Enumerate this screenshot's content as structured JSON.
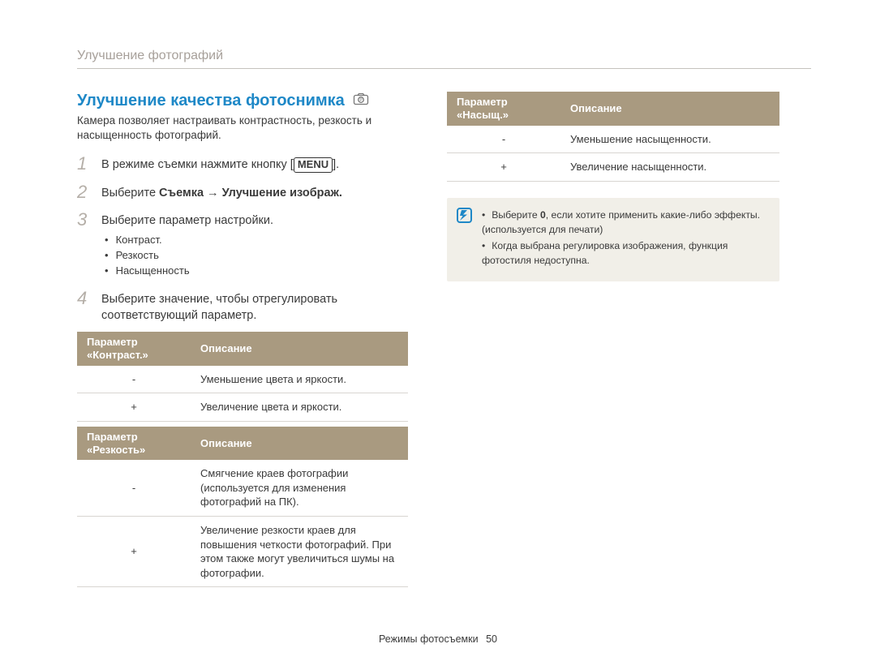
{
  "chapter": "Улучшение фотографий",
  "title": "Улучшение качества фотоснимка",
  "mode_icon_label": "camera-program-mode-icon",
  "intro": "Камера позволяет настраивать контрастность, резкость и насыщенность фотографий.",
  "steps": [
    {
      "num": "1",
      "pre": "В режиме съемки нажмите кнопку [",
      "btn": "MENU",
      "post": "]."
    },
    {
      "num": "2",
      "plain_pre": "Выберите ",
      "bold": "Съемка → Улучшение изображ.",
      "plain_post": ""
    },
    {
      "num": "3",
      "plain": "Выберите параметр настройки.",
      "bullets": [
        "Контраст.",
        "Резкость",
        "Насыщенность"
      ]
    },
    {
      "num": "4",
      "plain": "Выберите значение, чтобы отрегулировать соответствующий параметр."
    }
  ],
  "tables": {
    "contrast": {
      "h1": "Параметр «Контраст.»",
      "h2": "Описание",
      "rows": [
        {
          "sym": "-",
          "desc": "Уменьшение цвета и яркости."
        },
        {
          "sym": "+",
          "desc": "Увеличение цвета и яркости."
        }
      ]
    },
    "sharpness": {
      "h1": "Параметр «Резкость»",
      "h2": "Описание",
      "rows": [
        {
          "sym": "-",
          "desc": "Смягчение краев фотографии (используется для изменения фотографий на ПК)."
        },
        {
          "sym": "+",
          "desc": "Увеличение резкости краев для повышения четкости фотографий. При этом также могут увеличиться шумы на фотографии."
        }
      ]
    },
    "saturation": {
      "h1": "Параметр «Насыщ.»",
      "h2": "Описание",
      "rows": [
        {
          "sym": "-",
          "desc": "Уменьшение насыщенности."
        },
        {
          "sym": "+",
          "desc": "Увеличение насыщенности."
        }
      ]
    }
  },
  "notes": [
    "Выберите 0, если хотите применить какие-либо эффекты. (используется для печати)",
    "Когда выбрана регулировка изображения, функция фотостиля недоступна."
  ],
  "footer_section": "Режимы фотосъемки",
  "page_number": "50"
}
